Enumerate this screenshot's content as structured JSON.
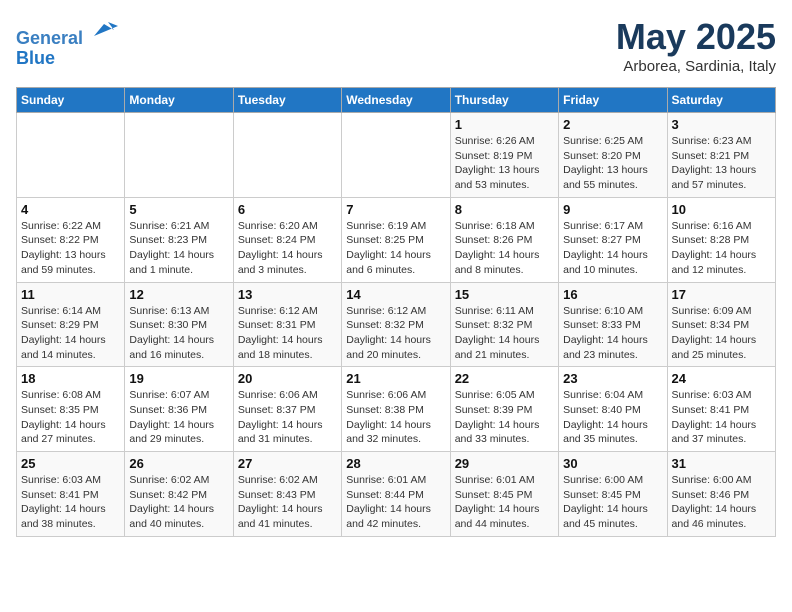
{
  "header": {
    "logo_line1": "General",
    "logo_line2": "Blue",
    "month": "May 2025",
    "location": "Arborea, Sardinia, Italy"
  },
  "weekdays": [
    "Sunday",
    "Monday",
    "Tuesday",
    "Wednesday",
    "Thursday",
    "Friday",
    "Saturday"
  ],
  "weeks": [
    [
      {
        "day": "",
        "info": ""
      },
      {
        "day": "",
        "info": ""
      },
      {
        "day": "",
        "info": ""
      },
      {
        "day": "",
        "info": ""
      },
      {
        "day": "1",
        "info": "Sunrise: 6:26 AM\nSunset: 8:19 PM\nDaylight: 13 hours\nand 53 minutes."
      },
      {
        "day": "2",
        "info": "Sunrise: 6:25 AM\nSunset: 8:20 PM\nDaylight: 13 hours\nand 55 minutes."
      },
      {
        "day": "3",
        "info": "Sunrise: 6:23 AM\nSunset: 8:21 PM\nDaylight: 13 hours\nand 57 minutes."
      }
    ],
    [
      {
        "day": "4",
        "info": "Sunrise: 6:22 AM\nSunset: 8:22 PM\nDaylight: 13 hours\nand 59 minutes."
      },
      {
        "day": "5",
        "info": "Sunrise: 6:21 AM\nSunset: 8:23 PM\nDaylight: 14 hours\nand 1 minute."
      },
      {
        "day": "6",
        "info": "Sunrise: 6:20 AM\nSunset: 8:24 PM\nDaylight: 14 hours\nand 3 minutes."
      },
      {
        "day": "7",
        "info": "Sunrise: 6:19 AM\nSunset: 8:25 PM\nDaylight: 14 hours\nand 6 minutes."
      },
      {
        "day": "8",
        "info": "Sunrise: 6:18 AM\nSunset: 8:26 PM\nDaylight: 14 hours\nand 8 minutes."
      },
      {
        "day": "9",
        "info": "Sunrise: 6:17 AM\nSunset: 8:27 PM\nDaylight: 14 hours\nand 10 minutes."
      },
      {
        "day": "10",
        "info": "Sunrise: 6:16 AM\nSunset: 8:28 PM\nDaylight: 14 hours\nand 12 minutes."
      }
    ],
    [
      {
        "day": "11",
        "info": "Sunrise: 6:14 AM\nSunset: 8:29 PM\nDaylight: 14 hours\nand 14 minutes."
      },
      {
        "day": "12",
        "info": "Sunrise: 6:13 AM\nSunset: 8:30 PM\nDaylight: 14 hours\nand 16 minutes."
      },
      {
        "day": "13",
        "info": "Sunrise: 6:12 AM\nSunset: 8:31 PM\nDaylight: 14 hours\nand 18 minutes."
      },
      {
        "day": "14",
        "info": "Sunrise: 6:12 AM\nSunset: 8:32 PM\nDaylight: 14 hours\nand 20 minutes."
      },
      {
        "day": "15",
        "info": "Sunrise: 6:11 AM\nSunset: 8:32 PM\nDaylight: 14 hours\nand 21 minutes."
      },
      {
        "day": "16",
        "info": "Sunrise: 6:10 AM\nSunset: 8:33 PM\nDaylight: 14 hours\nand 23 minutes."
      },
      {
        "day": "17",
        "info": "Sunrise: 6:09 AM\nSunset: 8:34 PM\nDaylight: 14 hours\nand 25 minutes."
      }
    ],
    [
      {
        "day": "18",
        "info": "Sunrise: 6:08 AM\nSunset: 8:35 PM\nDaylight: 14 hours\nand 27 minutes."
      },
      {
        "day": "19",
        "info": "Sunrise: 6:07 AM\nSunset: 8:36 PM\nDaylight: 14 hours\nand 29 minutes."
      },
      {
        "day": "20",
        "info": "Sunrise: 6:06 AM\nSunset: 8:37 PM\nDaylight: 14 hours\nand 31 minutes."
      },
      {
        "day": "21",
        "info": "Sunrise: 6:06 AM\nSunset: 8:38 PM\nDaylight: 14 hours\nand 32 minutes."
      },
      {
        "day": "22",
        "info": "Sunrise: 6:05 AM\nSunset: 8:39 PM\nDaylight: 14 hours\nand 33 minutes."
      },
      {
        "day": "23",
        "info": "Sunrise: 6:04 AM\nSunset: 8:40 PM\nDaylight: 14 hours\nand 35 minutes."
      },
      {
        "day": "24",
        "info": "Sunrise: 6:03 AM\nSunset: 8:41 PM\nDaylight: 14 hours\nand 37 minutes."
      }
    ],
    [
      {
        "day": "25",
        "info": "Sunrise: 6:03 AM\nSunset: 8:41 PM\nDaylight: 14 hours\nand 38 minutes."
      },
      {
        "day": "26",
        "info": "Sunrise: 6:02 AM\nSunset: 8:42 PM\nDaylight: 14 hours\nand 40 minutes."
      },
      {
        "day": "27",
        "info": "Sunrise: 6:02 AM\nSunset: 8:43 PM\nDaylight: 14 hours\nand 41 minutes."
      },
      {
        "day": "28",
        "info": "Sunrise: 6:01 AM\nSunset: 8:44 PM\nDaylight: 14 hours\nand 42 minutes."
      },
      {
        "day": "29",
        "info": "Sunrise: 6:01 AM\nSunset: 8:45 PM\nDaylight: 14 hours\nand 44 minutes."
      },
      {
        "day": "30",
        "info": "Sunrise: 6:00 AM\nSunset: 8:45 PM\nDaylight: 14 hours\nand 45 minutes."
      },
      {
        "day": "31",
        "info": "Sunrise: 6:00 AM\nSunset: 8:46 PM\nDaylight: 14 hours\nand 46 minutes."
      }
    ]
  ]
}
